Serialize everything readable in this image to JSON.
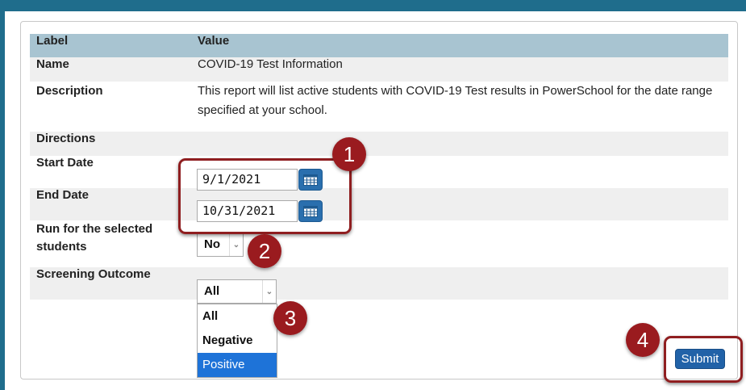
{
  "table": {
    "header": {
      "label": "Label",
      "value": "Value"
    },
    "name": {
      "label": "Name",
      "value": "COVID-19 Test Information"
    },
    "description": {
      "label": "Description",
      "value": "This report will list active students with COVID-19 Test results in PowerSchool for the date range specified at your school."
    },
    "directions": {
      "label": "Directions"
    },
    "start_date": {
      "label": "Start Date",
      "value": "9/1/2021"
    },
    "end_date": {
      "label": "End Date",
      "value": "10/31/2021"
    },
    "run_selected": {
      "label": "Run for the selected students",
      "value": "No"
    },
    "screening": {
      "label": "Screening Outcome",
      "value": "All",
      "options": [
        "All",
        "Negative",
        "Positive"
      ],
      "highlighted": "Positive"
    }
  },
  "submit_label": "Submit",
  "annotations": [
    "1",
    "2",
    "3",
    "4"
  ],
  "colors": {
    "header_bg": "#a8c4d1",
    "frame": "#1f6d8c",
    "callout": "#9a1b1f",
    "button": "#2162a8",
    "option_highlight": "#1e73d8"
  }
}
